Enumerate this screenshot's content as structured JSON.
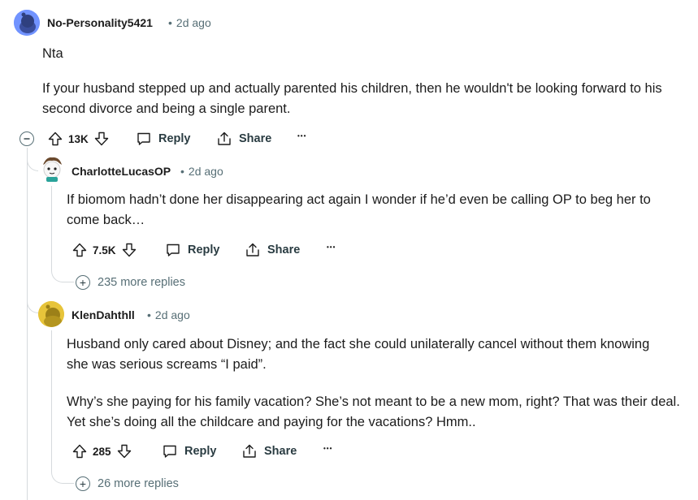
{
  "comments": [
    {
      "username": "No-Personality5421",
      "time": "2d ago",
      "paragraphs": [
        "Nta",
        "If your husband stepped up and actually parented his children, then he wouldn't be looking forward to his second divorce and being a single parent."
      ],
      "votes": "13K",
      "reply_label": "Reply",
      "share_label": "Share",
      "more_label": "•••"
    },
    {
      "username": "CharlotteLucasOP",
      "time": "2d ago",
      "paragraphs": [
        "If biomom hadn’t done her disappearing act again I wonder if he’d even be calling OP to beg her to come back…"
      ],
      "votes": "7.5K",
      "reply_label": "Reply",
      "share_label": "Share",
      "more_label": "•••",
      "more_replies": "235 more replies"
    },
    {
      "username": "KlenDahthll",
      "time": "2d ago",
      "paragraphs": [
        "Husband only cared about Disney; and the fact she could unilaterally cancel without them knowing she was serious screams “I paid”.",
        "Why’s she paying for his family vacation? She’s not meant to be a new mom, right? That was their deal. Yet she’s doing all the childcare and paying for the vacations? Hmm.."
      ],
      "votes": "285",
      "reply_label": "Reply",
      "share_label": "Share",
      "more_label": "•••",
      "more_replies": "26 more replies"
    }
  ],
  "meta_separator": "•",
  "icons": [
    "avatar-snoo",
    "collapse-icon",
    "upvote-icon",
    "downvote-icon",
    "comment-icon",
    "share-icon",
    "more-icon",
    "plus-icon"
  ],
  "colors": {
    "text": "#1c1c1c",
    "meta": "#576f76",
    "thread": "#d6dadd",
    "avatar1": "#7193ff",
    "avatar3": "#e7c43a"
  }
}
